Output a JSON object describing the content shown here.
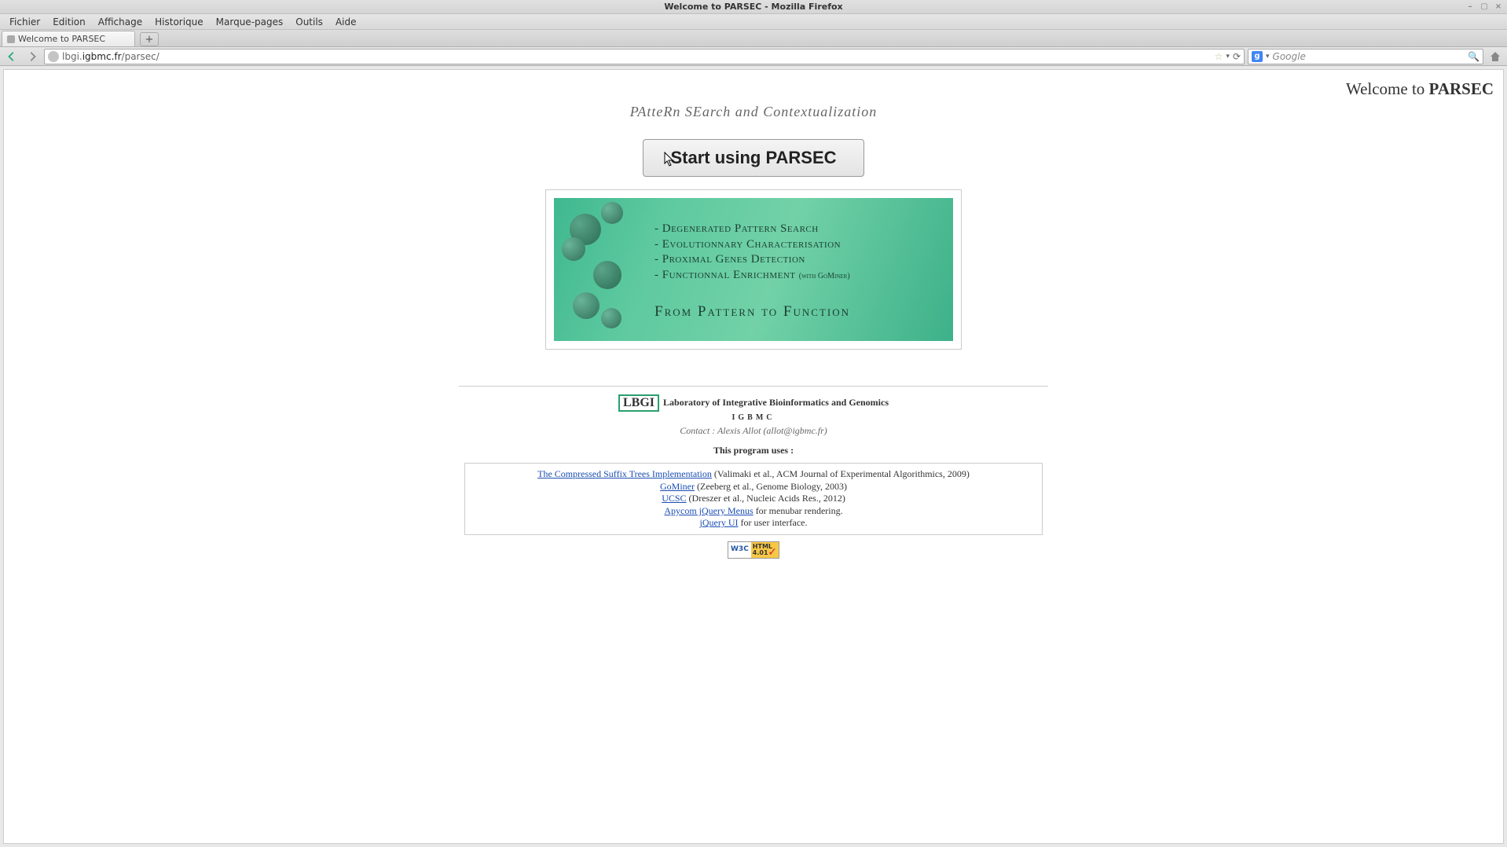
{
  "window": {
    "title": "Welcome to PARSEC - Mozilla Firefox"
  },
  "menubar": {
    "items": [
      "Fichier",
      "Edition",
      "Affichage",
      "Historique",
      "Marque-pages",
      "Outils",
      "Aide"
    ]
  },
  "tabs": {
    "active": {
      "title": "Welcome to PARSEC"
    },
    "new_tab_glyph": "+"
  },
  "nav": {
    "url_prefix": "lbgi.",
    "url_domain": "igbmc.fr",
    "url_path": "/parsec/",
    "search_engine_glyph": "g",
    "search_placeholder": "Google"
  },
  "page": {
    "welcome_prefix": "Welcome to ",
    "welcome_brand": "PARSEC",
    "tagline": "PAtteRn SEarch and Contextualization",
    "start_button": "Start using PARSEC",
    "banner": {
      "features": [
        "Degenerated Pattern Search",
        "Evolutionnary Characterisation",
        "Proximal Genes Detection",
        "Functionnal Enrichment"
      ],
      "feature_suffix": "(with GoMiner)",
      "slogan": "From Pattern to Function"
    },
    "footer": {
      "lbgi_badge": "LBGI",
      "lab_name": " Laboratory of Integrative Bioinformatics and Genomics",
      "igbmc": "IGBMC",
      "contact": "Contact : Alexis Allot (allot@igbmc.fr)",
      "uses": "This program uses :",
      "credits": [
        {
          "link": "The Compressed Suffix Trees Implementation",
          "rest": " (Valimaki et al., ACM Journal of Experimental Algorithmics, 2009)"
        },
        {
          "link": "GoMiner",
          "rest": " (Zeeberg et al., Genome Biology, 2003)"
        },
        {
          "link": "UCSC",
          "rest": " (Dreszer et al., Nucleic Acids Res., 2012)"
        },
        {
          "link": "Apycom jQuery Menus",
          "rest": " for menubar rendering."
        },
        {
          "link": "jQuery UI",
          "rest": " for user interface."
        }
      ],
      "w3c_left": "W3C",
      "w3c_right": "HTML 4.01"
    }
  }
}
